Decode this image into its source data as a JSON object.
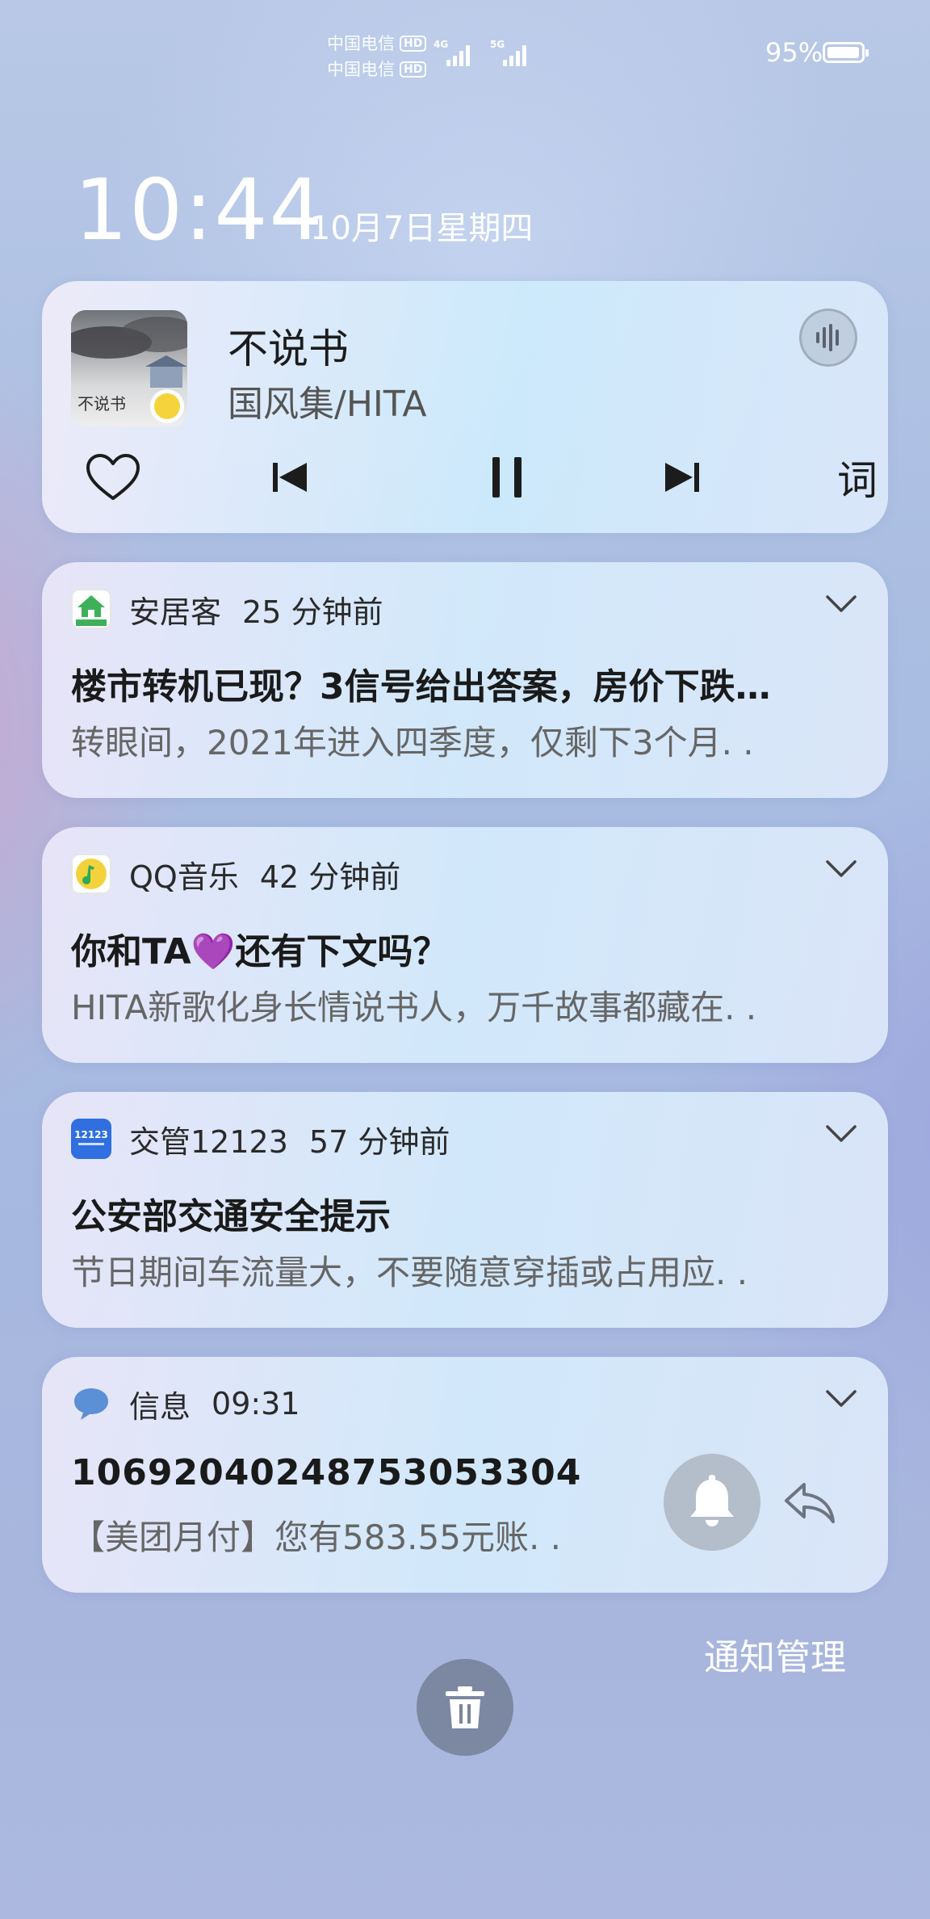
{
  "status_bar": {
    "carrier_1": "中国电信",
    "carrier_2": "中国电信",
    "hd_label": "HD",
    "net_1": "4G",
    "net_2": "5G",
    "battery": "95%"
  },
  "lockscreen": {
    "time": "10:44",
    "date": "10月7日星期四"
  },
  "music": {
    "app": "QQ音乐",
    "album_text": "不说书",
    "song": "不说书",
    "artist": "国风集/HITA",
    "lyric_label": "词",
    "icons": [
      "voice-assistant-icon",
      "heart-icon",
      "previous-icon",
      "pause-icon",
      "next-icon"
    ]
  },
  "notifications": [
    {
      "app": "安居客",
      "time": "25 分钟前",
      "title": "楼市转机已现？3信号给出答案，房价下跌…",
      "body": "转眼间，2021年进入四季度，仅剩下3个月. .",
      "icon_color": "#3fb05a"
    },
    {
      "app": "QQ音乐",
      "time": "42 分钟前",
      "title": "你和TA💜还有下文吗？",
      "body": "HITA新歌化身长情说书人，万千故事都藏在. .",
      "icon_color": "#f3d23c"
    },
    {
      "app": "交管12123",
      "time": "57 分钟前",
      "title": "公安部交通安全提示",
      "body": "节日期间车流量大，不要随意穿插或占用应. .",
      "icon_color": "#2f6fe0"
    },
    {
      "app": "信息",
      "time": "09:31",
      "title": "1069204024875305330​4",
      "body": "【美团月付】您有583.55元账. .",
      "icon_color": "#5b8fd6"
    }
  ],
  "footer": {
    "manage_label": "通知管理"
  },
  "colors": {
    "card_bg": "#dce9fb",
    "text_primary": "#1a1a1a",
    "text_secondary": "#666666"
  }
}
